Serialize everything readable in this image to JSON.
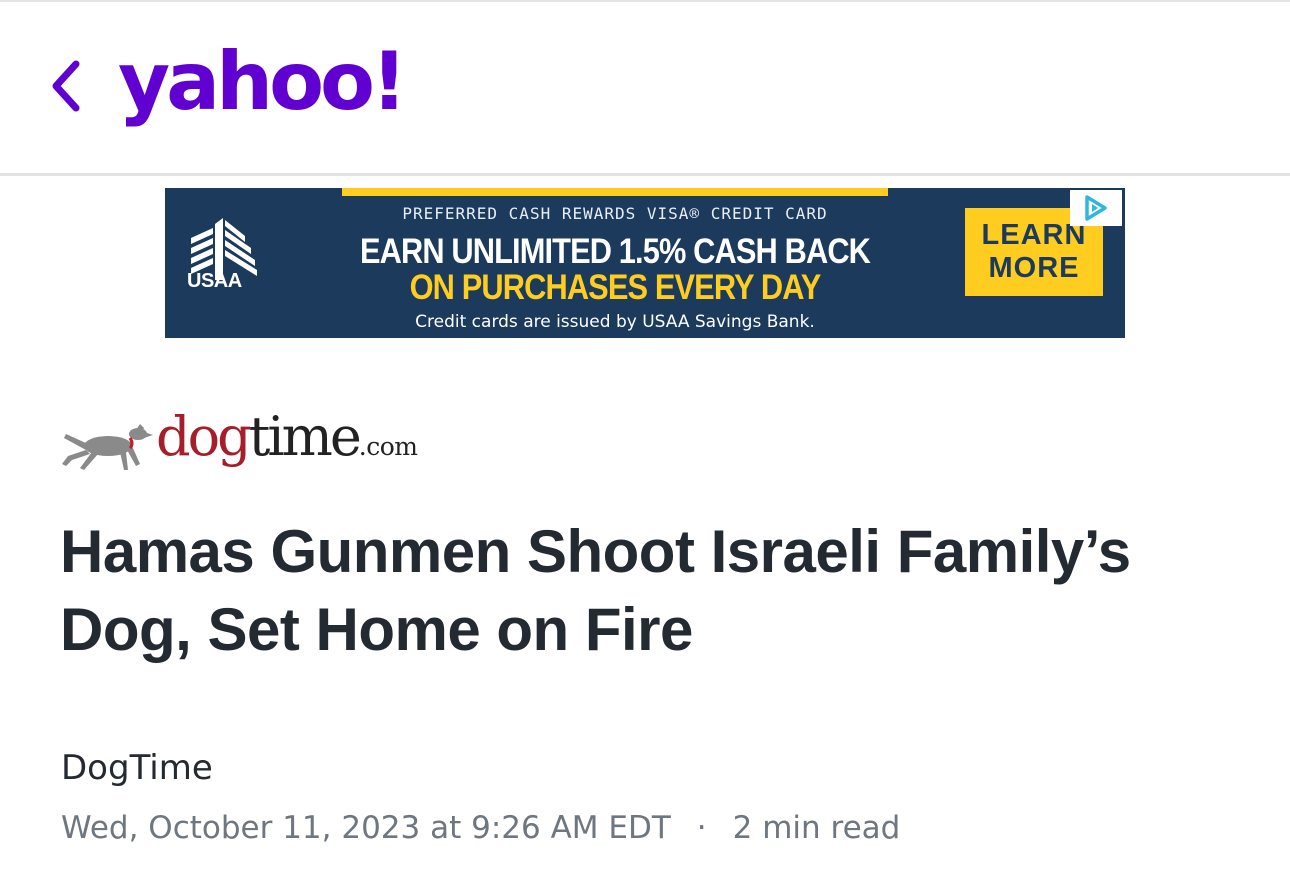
{
  "header": {
    "back_icon": "chevron-left-icon",
    "logo_text": "yahoo!",
    "brand_color": "#6001d2"
  },
  "ad": {
    "brand": "USAA",
    "kicker": "PREFERRED CASH REWARDS VISA® CREDIT CARD",
    "headline_line1": "EARN UNLIMITED 1.5% CASH BACK",
    "headline_line2": "ON PURCHASES EVERY DAY",
    "disclaimer": "Credit cards are issued by USAA Savings Bank.",
    "cta_line1": "LEARN",
    "cta_line2": "MORE",
    "choices_icon": "adchoices-icon",
    "background_color": "#1b3a5c",
    "accent_color": "#ffcd1f"
  },
  "article": {
    "publisher": {
      "name_part1": "dog",
      "name_part2": "time",
      "name_part3": ".com",
      "icon": "greyhound-dog-icon"
    },
    "headline": "Hamas Gunmen Shoot Israeli Family’s Dog, Set Home on Fire",
    "author": "DogTime",
    "date": "Wed, October 11, 2023 at 9:26 AM EDT",
    "separator": "·",
    "read_time": "2 min read"
  }
}
